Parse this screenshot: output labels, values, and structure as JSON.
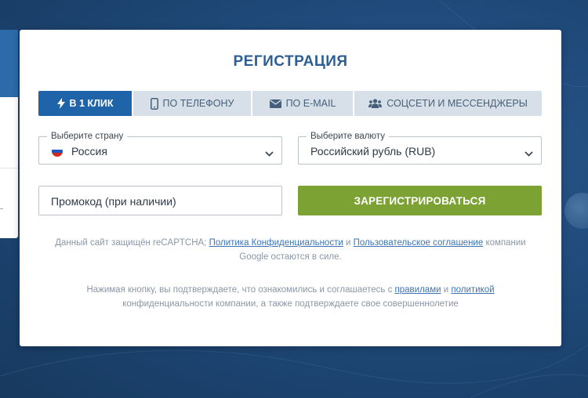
{
  "modal": {
    "title": "РЕГИСТРАЦИЯ"
  },
  "tabs": [
    {
      "label": "В 1 КЛИК",
      "icon": "lightning-icon",
      "active": true
    },
    {
      "label": "ПО ТЕЛЕФОНУ",
      "icon": "phone-icon",
      "active": false
    },
    {
      "label": "ПО E-MAIL",
      "icon": "envelope-icon",
      "active": false
    },
    {
      "label": "СОЦСЕТИ И МЕССЕНДЖЕРЫ",
      "icon": "users-icon",
      "active": false
    }
  ],
  "country": {
    "label": "Выберите страну",
    "value": "Россия",
    "flag_colors": [
      "#ffffff",
      "#1c57c4",
      "#d52b1e"
    ]
  },
  "currency": {
    "label": "Выберите валюту",
    "value": "Российский рубль (RUB)"
  },
  "promo": {
    "placeholder": "Промокод (при наличии)"
  },
  "register_button": {
    "label": "ЗАРЕГИСТРИРОВАТЬСЯ"
  },
  "recaptcha_notice": {
    "text_before": "Данный сайт защищён reCAPTCHA; ",
    "privacy_link": "Политика Конфиденциальности",
    "and": " и ",
    "terms_link": "Пользовательское соглашение",
    "text_after": " компании Google остаются в силе."
  },
  "consent_notice": {
    "text_before": "Нажимая кнопку, вы подтверждаете, что ознакомились и соглашаетесь с ",
    "rules_link": "правилами",
    "and": " и ",
    "policy_link": "политикой",
    "text_after": " конфиденциальности компании, а также подтверждаете свое совершеннолетие"
  },
  "colors": {
    "accent_blue": "#1f63a8",
    "title_blue": "#2d5f94",
    "register_green": "#7ba233",
    "link_blue": "#3d74b3"
  }
}
